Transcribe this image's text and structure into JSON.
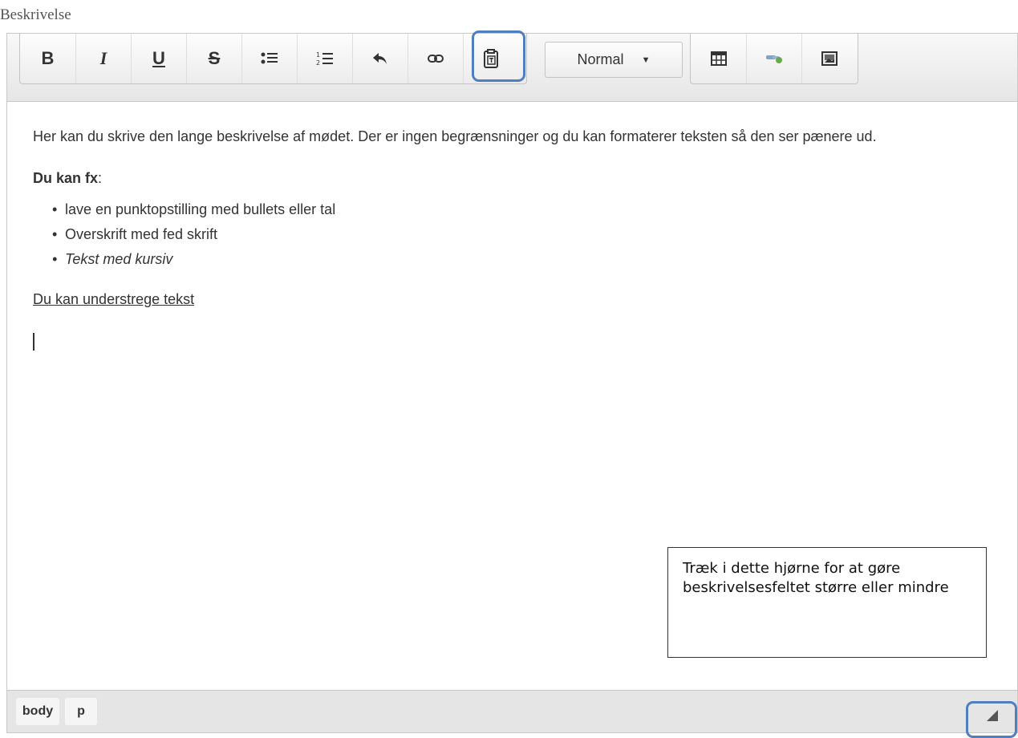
{
  "field": {
    "label": "Beskrivelse"
  },
  "toolbar": {
    "buttons": [
      {
        "label": "B",
        "name": "bold-button"
      },
      {
        "label": "I",
        "name": "italic-button"
      },
      {
        "label": "U",
        "name": "underline-button"
      },
      {
        "label": "S",
        "name": "strikethrough-button"
      },
      {
        "icon": "bulleted-list-icon",
        "name": "bulleted-list-button"
      },
      {
        "icon": "numbered-list-icon",
        "name": "numbered-list-button"
      },
      {
        "icon": "undo-icon",
        "name": "undo-button"
      },
      {
        "icon": "link-icon",
        "name": "link-button"
      },
      {
        "icon": "paste-as-text-icon",
        "name": "paste-as-text-button"
      }
    ],
    "format_select": {
      "value": "Normal"
    },
    "insert_buttons": [
      {
        "icon": "table-icon",
        "name": "insert-table-button"
      },
      {
        "icon": "hyperlink-key-icon",
        "name": "insert-link-button"
      },
      {
        "icon": "image-icon",
        "name": "insert-image-button"
      }
    ],
    "highlight_color": "#4f7fbf"
  },
  "content": {
    "paragraph1": "Her kan du skrive den lange beskrivelse af mødet. Der er ingen begrænsninger og du kan formaterer teksten så den ser pænere ud.",
    "heading_bold": "Du kan fx",
    "heading_suffix": ":",
    "list": [
      "lave en punktopstilling med bullets eller tal",
      "Overskrift med fed skrift",
      "Tekst med kursiv"
    ],
    "underlined": "Du kan understrege tekst"
  },
  "statusbar": {
    "path": [
      "body",
      "p"
    ]
  },
  "callout": {
    "text": "Træk i dette hjørne for at gøre beskrivelsesfeltet større eller mindre"
  }
}
